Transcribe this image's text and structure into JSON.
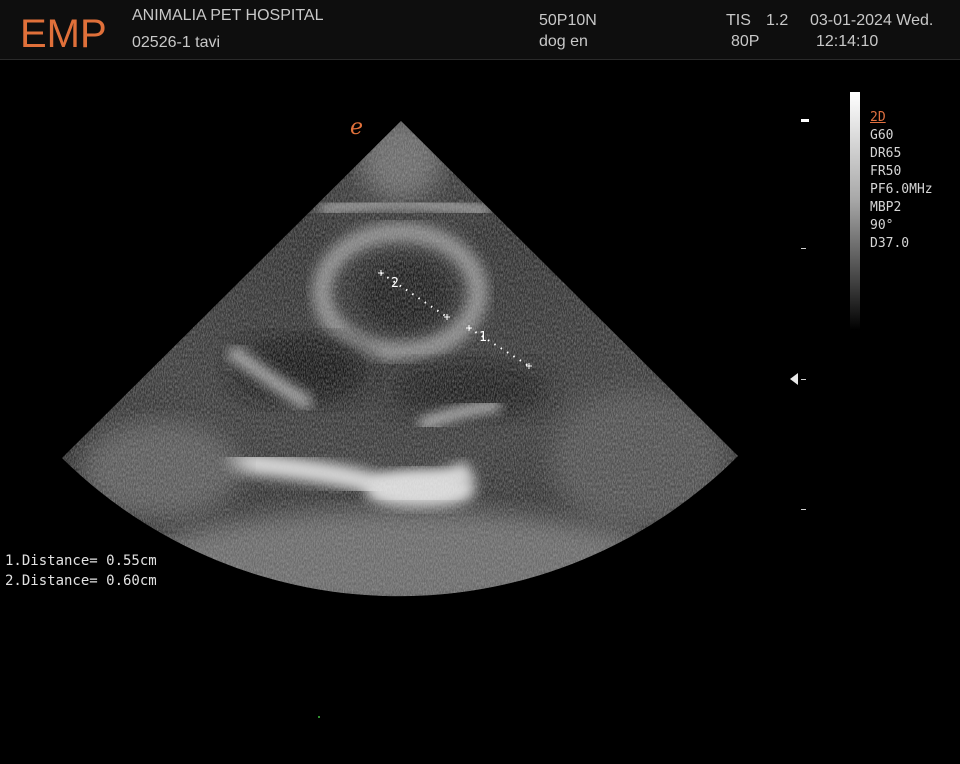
{
  "header": {
    "logo": "EMP",
    "hospital": "ANIMALIA PET HOSPITAL",
    "patient": "02526-1  tavi",
    "probe": "50P10N",
    "preset": "dog en",
    "tis_label": "TIS",
    "tis_value": "1.2",
    "power": "80P",
    "date": "03-01-2024 Wed.",
    "time": "12:14:10"
  },
  "scan": {
    "orientation_mark": "e",
    "params": {
      "mode": "2D",
      "gain": "G60",
      "dynamic_range": "DR65",
      "frame_rate": "FR50",
      "frequency": "PF6.0MHz",
      "mbp": "MBP2",
      "angle": "90°",
      "depth": "D37.0"
    },
    "caliper_labels": [
      "1",
      "2"
    ],
    "measurements": [
      "1.Distance= 0.55cm",
      "2.Distance= 0.60cm"
    ]
  }
}
